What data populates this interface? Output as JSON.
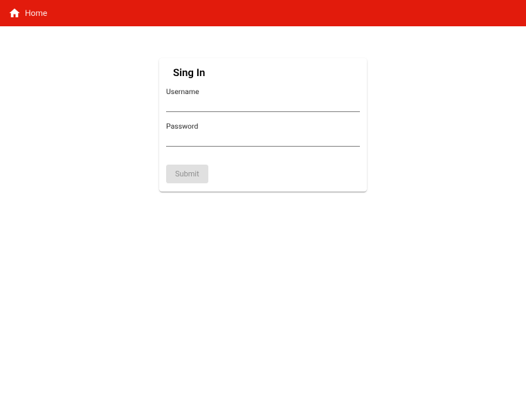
{
  "header": {
    "home_label": "Home"
  },
  "signin": {
    "title": "Sing In",
    "username_label": "Username",
    "username_value": "",
    "password_label": "Password",
    "password_value": "",
    "submit_label": "Submit"
  }
}
